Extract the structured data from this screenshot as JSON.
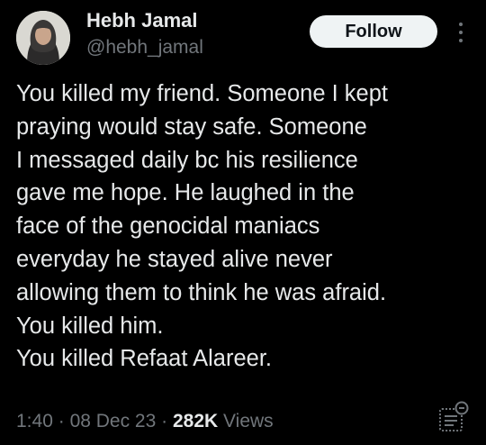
{
  "author": {
    "name": "Hebh Jamal",
    "handle": "@hebh_jamal",
    "avatar_icon": "profile-photo-woman-headscarf"
  },
  "actions": {
    "follow_label": "Follow",
    "more_icon": "more-vertical-icon"
  },
  "tweet": {
    "lines": [
      "You killed my friend. Someone I kept",
      "praying would stay safe. Someone",
      "I messaged daily bc his resilience",
      "gave me hope. He laughed in the",
      "face of the genocidal maniacs",
      "everyday he stayed alive never",
      "allowing them to think he was afraid.",
      "You killed him.",
      "You killed Refaat Alareer."
    ]
  },
  "meta": {
    "time": "1:40",
    "separator": "·",
    "date": "08 Dec 23",
    "views_count": "282K",
    "views_label": "Views",
    "analytics_icon": "analytics-icon"
  },
  "colors": {
    "background": "#000000",
    "primary_text": "#e7e9ea",
    "secondary_text": "#71767b",
    "button_bg": "#eff3f4",
    "button_text": "#0f1419"
  }
}
